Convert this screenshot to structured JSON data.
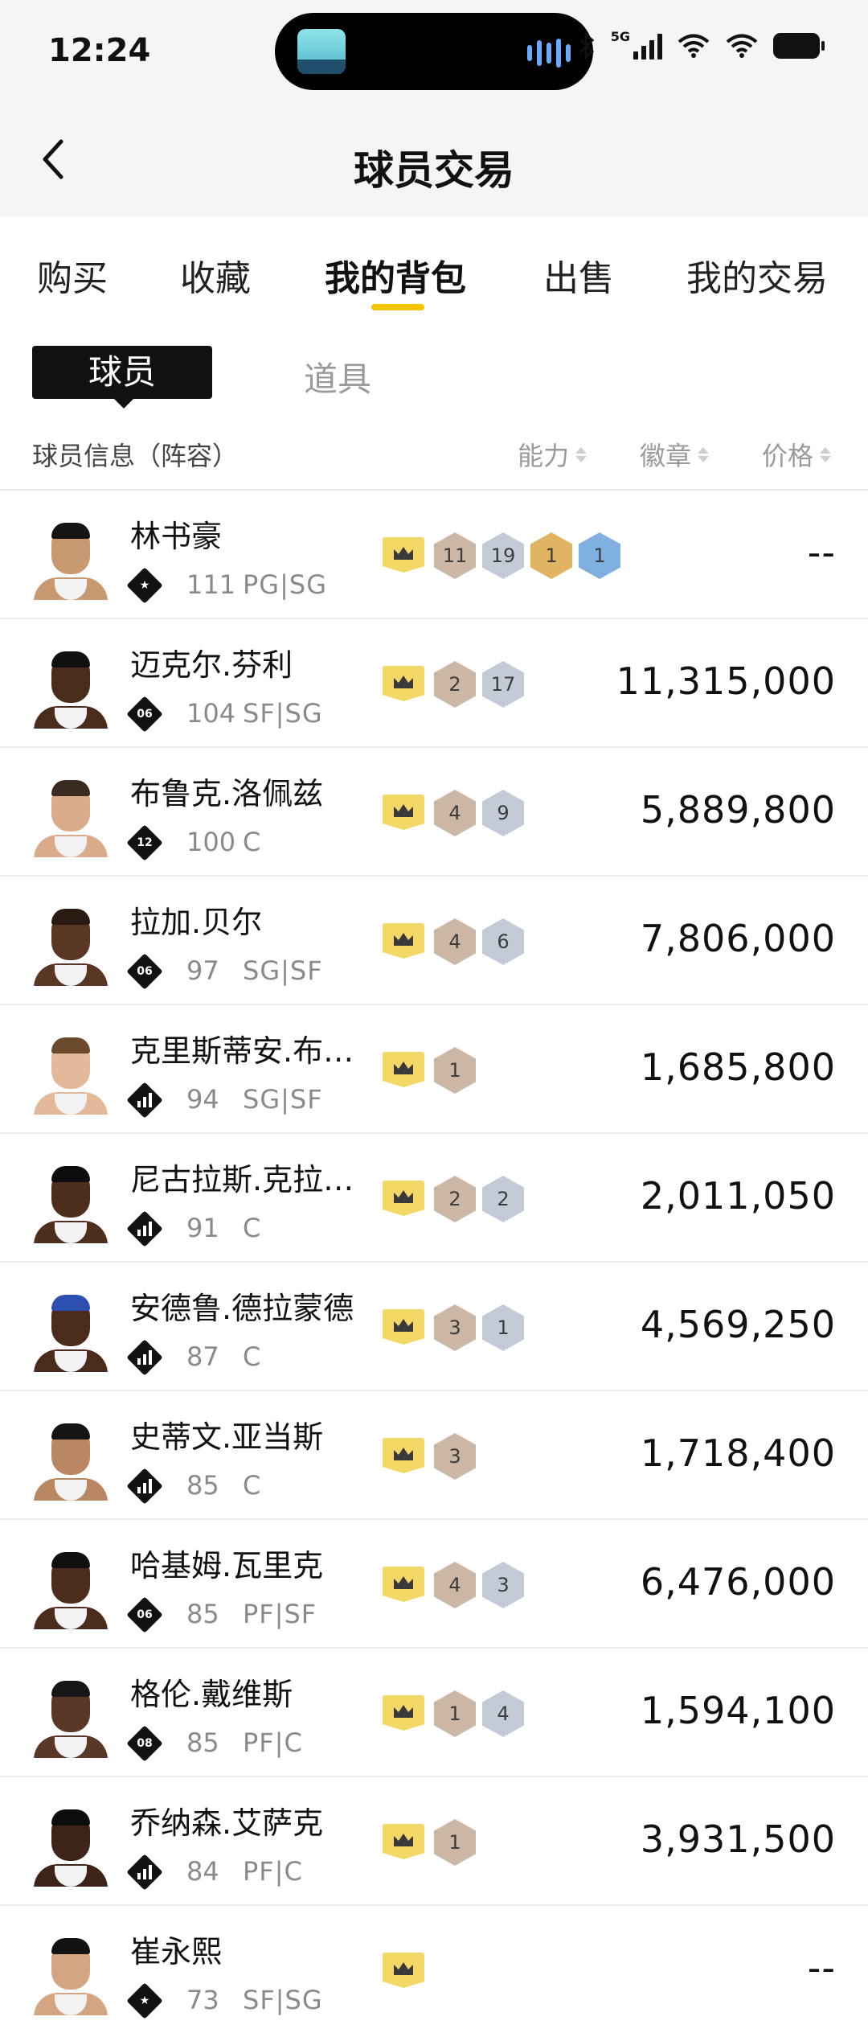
{
  "status_bar": {
    "time": "12:24",
    "network": "5G"
  },
  "header": {
    "title": "球员交易"
  },
  "tabs": [
    "购买",
    "收藏",
    "我的背包",
    "出售",
    "我的交易"
  ],
  "active_tab": "我的背包",
  "sub_tabs": {
    "active": "球员",
    "inactive": "道具"
  },
  "columns": {
    "info": "球员信息（阵容）",
    "ability": "能力",
    "badges": "徽章",
    "price": "价格"
  },
  "players": [
    {
      "name": "林书豪",
      "rank": "★",
      "ovr": "111",
      "pos": "PG|SG",
      "badges": [
        {
          "n": "11",
          "t": "bronze"
        },
        {
          "n": "19",
          "t": "silver"
        },
        {
          "n": "1",
          "t": "gold"
        },
        {
          "n": "1",
          "t": "ruby"
        }
      ],
      "price": "--",
      "skin": "#c99a72",
      "hair": "#151515"
    },
    {
      "name": "迈克尔.芬利",
      "rank": "06",
      "ovr": "104",
      "pos": "SF|SG",
      "badges": [
        {
          "n": "2",
          "t": "bronze"
        },
        {
          "n": "17",
          "t": "silver"
        }
      ],
      "price": "11,315,000",
      "skin": "#4a2c1c",
      "hair": "#101010"
    },
    {
      "name": "布鲁克.洛佩兹",
      "rank": "12",
      "ovr": "100",
      "pos": "C",
      "badges": [
        {
          "n": "4",
          "t": "bronze"
        },
        {
          "n": "9",
          "t": "silver"
        }
      ],
      "price": "5,889,800",
      "skin": "#d9ab8a",
      "hair": "#3a2a20"
    },
    {
      "name": "拉加.贝尔",
      "rank": "06",
      "ovr": "97",
      "pos": "SG|SF",
      "badges": [
        {
          "n": "4",
          "t": "bronze"
        },
        {
          "n": "6",
          "t": "silver"
        }
      ],
      "price": "7,806,000",
      "skin": "#5a3624",
      "hair": "#2a1a12"
    },
    {
      "name": "克里斯蒂安.布…",
      "rank": "bars",
      "ovr": "94",
      "pos": "SG|SF",
      "badges": [
        {
          "n": "1",
          "t": "bronze"
        }
      ],
      "price": "1,685,800",
      "skin": "#e4b999",
      "hair": "#6b4a2d"
    },
    {
      "name": "尼古拉斯.克拉…",
      "rank": "bars",
      "ovr": "91",
      "pos": "C",
      "badges": [
        {
          "n": "2",
          "t": "bronze"
        },
        {
          "n": "2",
          "t": "silver"
        }
      ],
      "price": "2,011,050",
      "skin": "#4e2f1e",
      "hair": "#0d0d0d"
    },
    {
      "name": "安德鲁.德拉蒙德",
      "rank": "bars",
      "ovr": "87",
      "pos": "C",
      "badges": [
        {
          "n": "3",
          "t": "bronze"
        },
        {
          "n": "1",
          "t": "silver"
        }
      ],
      "price": "4,569,250",
      "skin": "#4a2b1c",
      "hair": "#2d4fb0"
    },
    {
      "name": "史蒂文.亚当斯",
      "rank": "bars",
      "ovr": "85",
      "pos": "C",
      "badges": [
        {
          "n": "3",
          "t": "bronze"
        }
      ],
      "price": "1,718,400",
      "skin": "#b98862",
      "hair": "#151515"
    },
    {
      "name": "哈基姆.瓦里克",
      "rank": "06",
      "ovr": "85",
      "pos": "PF|SF",
      "badges": [
        {
          "n": "4",
          "t": "bronze"
        },
        {
          "n": "3",
          "t": "silver"
        }
      ],
      "price": "6,476,000",
      "skin": "#4c2d1d",
      "hair": "#0f0f0f"
    },
    {
      "name": "格伦.戴维斯",
      "rank": "08",
      "ovr": "85",
      "pos": "PF|C",
      "badges": [
        {
          "n": "1",
          "t": "bronze"
        },
        {
          "n": "4",
          "t": "silver"
        }
      ],
      "price": "1,594,100",
      "skin": "#5a3828",
      "hair": "#161616"
    },
    {
      "name": "乔纳森.艾萨克",
      "rank": "bars",
      "ovr": "84",
      "pos": "PF|C",
      "badges": [
        {
          "n": "1",
          "t": "bronze"
        }
      ],
      "price": "3,931,500",
      "skin": "#3e2418",
      "hair": "#0c0c0c"
    },
    {
      "name": "崔永熙",
      "rank": "★",
      "ovr": "73",
      "pos": "SF|SG",
      "badges": [],
      "price": "--",
      "skin": "#d4a582",
      "hair": "#121212"
    }
  ],
  "colors": {
    "accent": "#f5c400",
    "crown": "#f4d866",
    "badge_bronze": "#cbb7a3",
    "badge_silver": "#c3cbd6",
    "badge_gold": "#e0b463",
    "badge_ruby": "#7fb0df"
  }
}
